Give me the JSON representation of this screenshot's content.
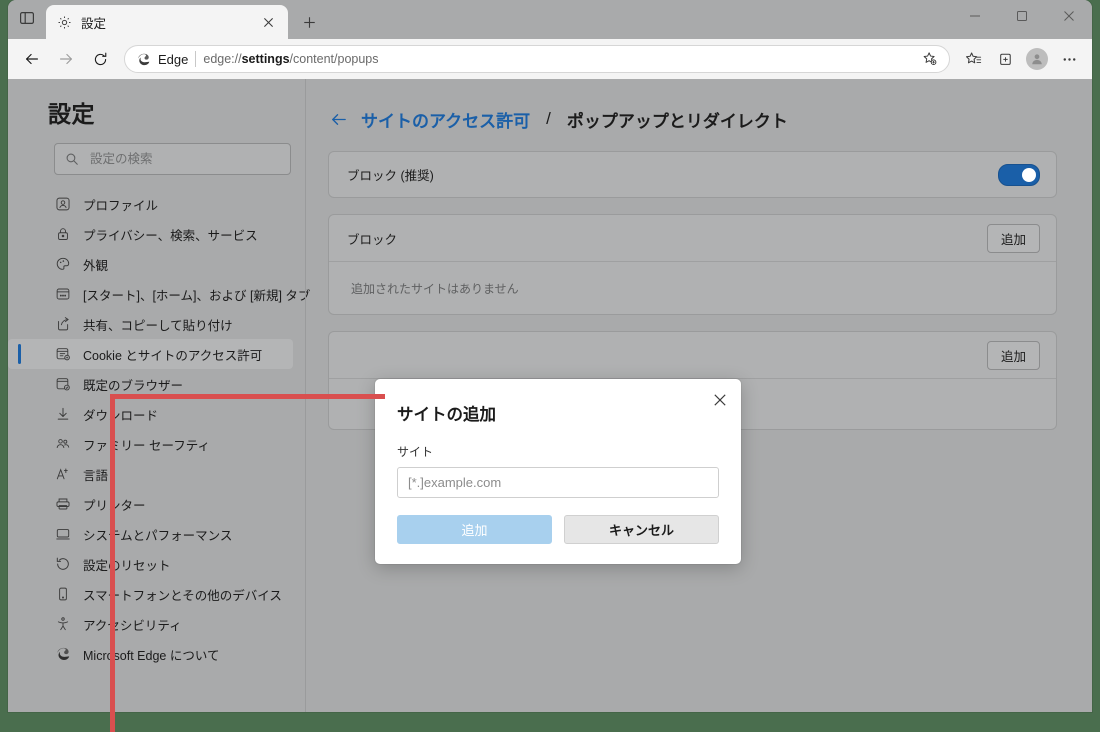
{
  "window": {
    "tab_strip_icon": "tab-list-icon",
    "tabs": [
      {
        "favicon": "gear-icon",
        "title": "設定",
        "close": "close-icon"
      }
    ],
    "new_tab_label": "+",
    "controls": {
      "minimize": "minimize-icon",
      "maximize": "maximize-icon",
      "close": "close-icon"
    }
  },
  "nav": {
    "back": "back-arrow-icon",
    "forward": "forward-arrow-icon",
    "reload": "reload-icon",
    "omnibox": {
      "brand_icon": "edge-logo-icon",
      "brand_label": "Edge",
      "url_prefix": "edge://",
      "url_bold": "settings",
      "url_suffix": "/content/popups",
      "url_full": "edge://settings/content/popups",
      "favorite_icon": "add-favorite-icon"
    },
    "toolbar_icons": [
      {
        "name": "favorites-icon"
      },
      {
        "name": "collections-icon"
      }
    ],
    "profile_icon": "avatar-icon",
    "more_icon": "more-options-icon"
  },
  "sidebar": {
    "title": "設定",
    "search": {
      "icon": "search-icon",
      "placeholder": "設定の検索",
      "value": ""
    },
    "items": [
      {
        "icon": "profile-icon",
        "label": "プロファイル",
        "active": false
      },
      {
        "icon": "lock-icon",
        "label": "プライバシー、検索、サービス",
        "active": false
      },
      {
        "icon": "palette-icon",
        "label": "外観",
        "active": false
      },
      {
        "icon": "start-home-tab-icon",
        "label": "[スタート]、[ホーム]、および [新規] タブ",
        "active": false
      },
      {
        "icon": "share-copy-paste-icon",
        "label": "共有、コピーして貼り付け",
        "active": false
      },
      {
        "icon": "cookies-site-permissions-icon",
        "label": "Cookie とサイトのアクセス許可",
        "active": true
      },
      {
        "icon": "default-browser-icon",
        "label": "既定のブラウザー",
        "active": false
      },
      {
        "icon": "download-icon",
        "label": "ダウンロード",
        "active": false
      },
      {
        "icon": "family-safety-icon",
        "label": "ファミリー セーフティ",
        "active": false
      },
      {
        "icon": "languages-icon",
        "label": "言語",
        "active": false
      },
      {
        "icon": "printer-icon",
        "label": "プリンター",
        "active": false
      },
      {
        "icon": "system-performance-icon",
        "label": "システムとパフォーマンス",
        "active": false
      },
      {
        "icon": "reset-settings-icon",
        "label": "設定のリセット",
        "active": false
      },
      {
        "icon": "phone-devices-icon",
        "label": "スマートフォンとその他のデバイス",
        "active": false
      },
      {
        "icon": "accessibility-icon",
        "label": "アクセシビリティ",
        "active": false
      },
      {
        "icon": "edge-logo-icon",
        "label": "Microsoft Edge について",
        "active": false
      }
    ]
  },
  "content": {
    "breadcrumb": {
      "back_icon": "back-arrow-icon",
      "parent": "サイトのアクセス許可",
      "separator": "/",
      "current": "ポップアップとリダイレクト"
    },
    "cards": [
      {
        "name": "block-recommended-card",
        "label": "ブロック (推奨)",
        "control": "toggle",
        "toggle_on": true
      },
      {
        "name": "block-list-card",
        "label": "ブロック",
        "control": "add-button",
        "add_label": "追加",
        "empty_text": "追加されたサイトはありません"
      },
      {
        "name": "allow-list-card",
        "label": "",
        "control": "add-button",
        "add_label": "追加",
        "empty_text": ""
      }
    ]
  },
  "dialog": {
    "name": "add-site-dialog",
    "title": "サイトの追加",
    "close_icon": "close-icon",
    "field_label": "サイト",
    "input": {
      "placeholder": "[*.]example.com",
      "value": ""
    },
    "primary_button": {
      "label": "追加",
      "disabled": true
    },
    "secondary_button": {
      "label": "キャンセル"
    }
  },
  "annotation": {
    "color": "#d94f4f",
    "shape": "L-shaped pointer line to site input field"
  },
  "colors": {
    "accent_blue": "#1a5fa8",
    "link_blue": "#1a5fa8",
    "annotation_red": "#d94f4f",
    "desktop_green": "#4a6e4e",
    "disabled_primary": "#a8d0ee"
  }
}
